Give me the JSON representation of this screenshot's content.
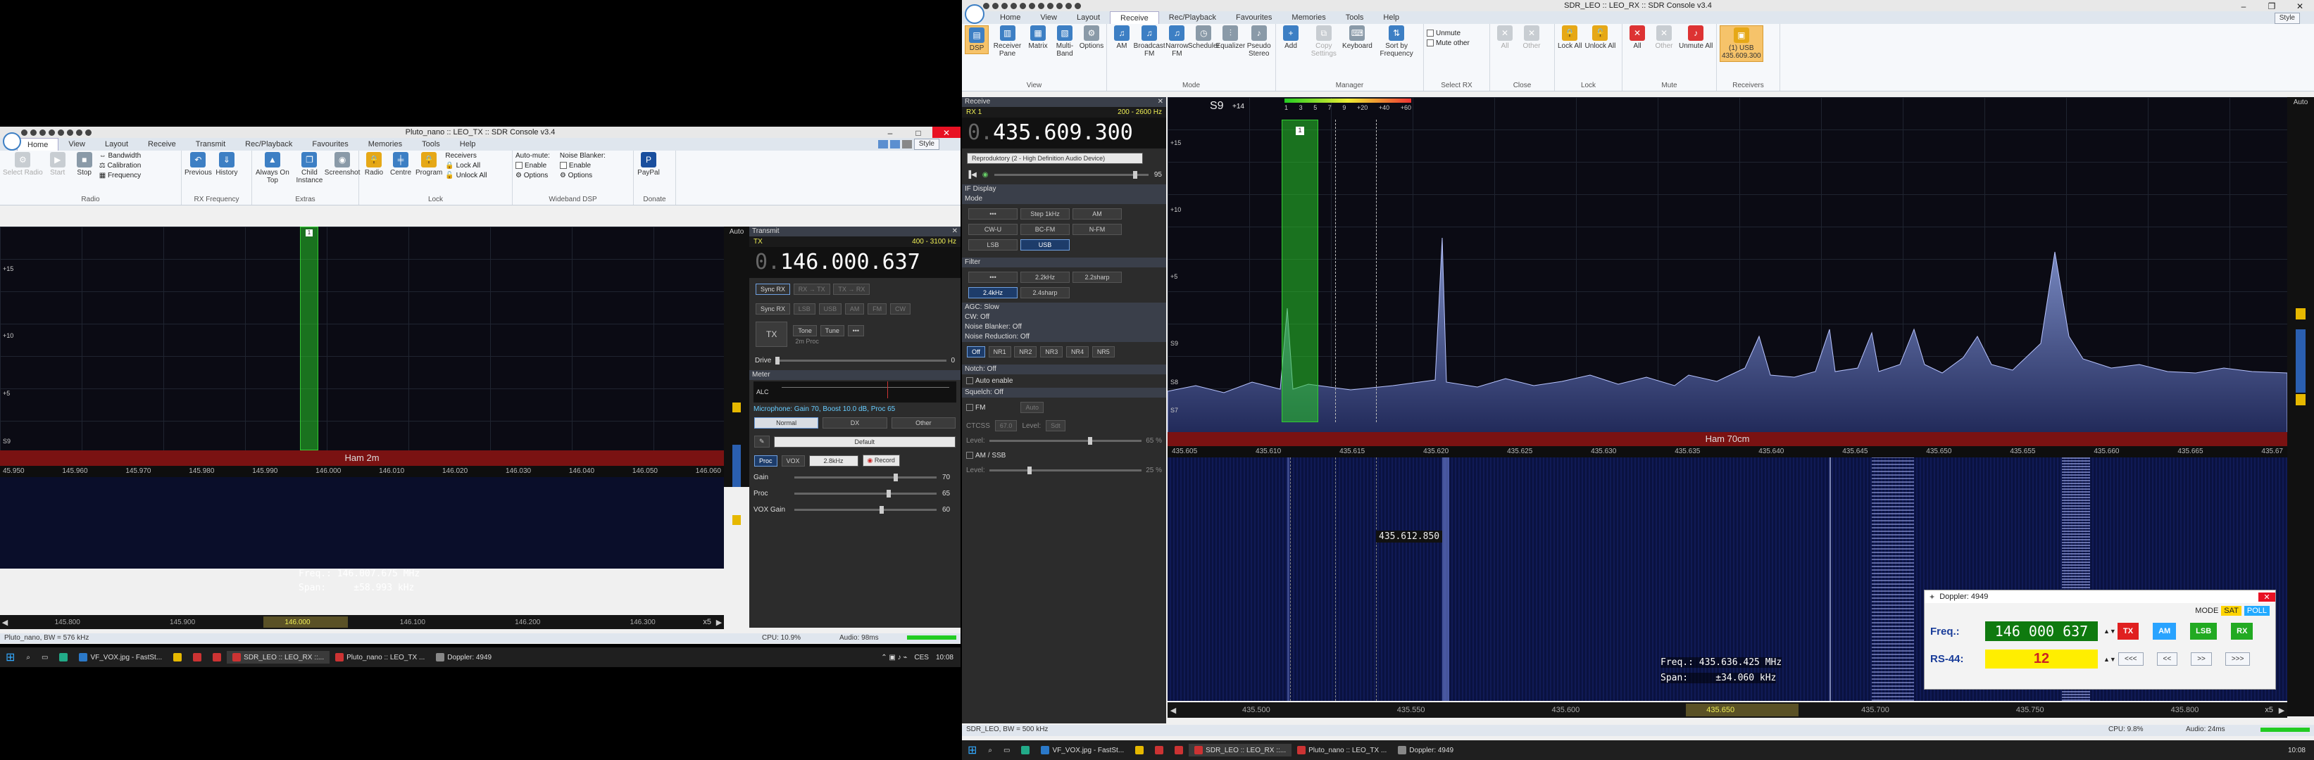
{
  "tx_window": {
    "title": "Pluto_nano :: LEO_TX :: SDR Console v3.4",
    "tabs": [
      "Home",
      "View",
      "Layout",
      "Receive",
      "Transmit",
      "Rec/Playback",
      "Favourites",
      "Memories",
      "Tools",
      "Help"
    ],
    "style_label": "Style",
    "ribbon": {
      "select_radio": "Select Radio",
      "start": "Start",
      "stop": "Stop",
      "bandwidth": "Bandwidth",
      "calibration": "Calibration",
      "frequency": "Frequency",
      "previous": "Previous",
      "history": "History",
      "always_on_top": "Always On Top",
      "child_instance": "Child Instance",
      "screenshot": "Screenshot",
      "radio": "Radio",
      "centre": "Centre",
      "program": "Program",
      "receivers": "Receivers",
      "lock_all": "Lock All",
      "unlock_all": "Unlock All",
      "auto_mute": "Auto-mute:",
      "enable": "Enable",
      "options": "Options",
      "noise_blanker": "Noise Blanker:",
      "paypal": "PayPal",
      "groups": [
        "Radio",
        "RX Frequency",
        "Extras",
        "Lock",
        "Wideband DSP",
        "Donate"
      ]
    },
    "spectrum_scale": [
      "+15",
      "+10",
      "+5",
      "S9"
    ],
    "auto_label": "Auto",
    "band_label": "Ham 2m",
    "freq_axis": [
      "45.950",
      "145.960",
      "145.970",
      "145.980",
      "145.990",
      "146.000",
      "146.010",
      "146.020",
      "146.030",
      "146.040",
      "146.050",
      "146.060"
    ],
    "cursor_freq": "Freq.: 146.007.675 MHz",
    "cursor_span": "Span:     ±58.993 kHz",
    "overview_axis": [
      "145.800",
      "145.900",
      "146.000",
      "146.100",
      "146.200",
      "146.300"
    ],
    "zoom": "x5",
    "status_left": "Pluto_nano, BW = 576 kHz",
    "cpu": "CPU: 10.9%",
    "audio": "Audio: 98ms",
    "transmit_panel": {
      "header": "Transmit",
      "tx_label": "TX",
      "filter_range": "400 - 3100 Hz",
      "freq_prefix": "0.",
      "frequency": "146.000.637",
      "sync_rx": "Sync RX",
      "rx_tx": "RX → TX",
      "tx_rx": "TX → RX",
      "modes": [
        "LSB",
        "USB",
        "AM",
        "FM",
        "CW"
      ],
      "tx_button": "TX",
      "tone": "Tone",
      "tune": "Tune",
      "more": "•••",
      "proc_label": "2m Proc",
      "drive": "Drive",
      "drive_value": "0",
      "meter_header": "Meter",
      "alc": "ALC",
      "mic_line": "Microphone: Gain 70, Boost 10.0 dB, Proc 65",
      "mic_tabs": [
        "Normal",
        "DX",
        "Other"
      ],
      "preset": "Default",
      "proc": "Proc",
      "vox": "VOX",
      "bw": "2.8kHz",
      "record": "Record",
      "gain": "Gain",
      "gain_value": "70",
      "proc_slider": "Proc",
      "proc_value": "65",
      "vox_gain": "VOX Gain",
      "vox_value": "60"
    }
  },
  "rx_window": {
    "title": "SDR_LEO :: LEO_RX :: SDR Console v3.4",
    "tabs": [
      "Home",
      "View",
      "Layout",
      "Receive",
      "Rec/Playback",
      "Favourites",
      "Memories",
      "Tools",
      "Help"
    ],
    "active_tab": "Receive",
    "style_label": "Style",
    "ribbon": {
      "dsp": "DSP",
      "receiver_pane": "Receiver Pane",
      "matrix": "Matrix",
      "multi_band": "Multi-Band",
      "options": "Options",
      "am": "AM",
      "broadcast_fm": "Broadcast FM",
      "narrow_fm": "Narrow FM",
      "scheduler": "Scheduler",
      "equalizer": "Equalizer",
      "pseudo_stereo": "Pseudo Stereo",
      "add": "Add",
      "copy_settings": "Copy Settings",
      "keyboard": "Keyboard",
      "sort_by_frequency": "Sort by Frequency",
      "unmute": "Unmute",
      "mute_other": "Mute other",
      "all": "All",
      "other": "Other",
      "lock_all": "Lock All",
      "unlock_all": "Unlock All",
      "unmute_all": "Unmute All",
      "rx1_usb": "(1) USB",
      "rx1_freq": "435.609.300",
      "groups": [
        "View",
        "Mode",
        "Manager",
        "Select RX",
        "Close",
        "Lock",
        "Mute",
        "Receivers"
      ]
    },
    "receive_panel": {
      "header": "Receive",
      "rx_label": "RX 1",
      "filter_range": "200 - 2600 Hz",
      "freq_prefix": "0.",
      "frequency": "435.609.300",
      "audio_device": "Reproduktory (2 - High Definition Audio Device)",
      "volume": "95",
      "if_display": "IF Display",
      "mode_header": "Mode",
      "modes": [
        "•••",
        "Step 1kHz",
        "AM",
        "CW-U",
        "BC-FM",
        "N-FM",
        "LSB",
        "USB"
      ],
      "active_mode": "USB",
      "filter_header": "Filter",
      "filters": [
        "•••",
        "2.2kHz",
        "2.2sharp",
        "2.4kHz",
        "2.4sharp"
      ],
      "agc": "AGC: Slow",
      "cw": "CW: Off",
      "noise_blanker": "Noise Blanker: Off",
      "noise_reduction": "Noise Reduction: Off",
      "nr_buttons": [
        "Off",
        "NR1",
        "NR2",
        "NR3",
        "NR4",
        "NR5"
      ],
      "notch": "Notch: Off",
      "auto_enable": "Auto enable",
      "squelch": "Squelch: Off",
      "fm": "FM",
      "auto": "Auto",
      "ctcss": "CTCSS",
      "ctcss_val": "67.0",
      "level": "Level:",
      "level_val": "Sdt",
      "level_pct": "65 %",
      "am_ssb": "AM / SSB",
      "level2_pct": "25 %"
    },
    "s_meter_label": "S9",
    "s_meter_plus": "+14",
    "s_meter_scale": [
      "1",
      "3",
      "5",
      "7",
      "9",
      "+20",
      "+40",
      "+60"
    ],
    "spectrum_scale": [
      "+15",
      "+10",
      "+5",
      "S9",
      "S8",
      "S7"
    ],
    "auto_label": "Auto",
    "band_label": "Ham 70cm",
    "freq_axis": [
      "435.605",
      "435.610",
      "435.615",
      "435.620",
      "435.625",
      "435.630",
      "435.635",
      "435.640",
      "435.645",
      "435.650",
      "435.655",
      "435.660",
      "435.665",
      "435.67"
    ],
    "wf_marker": "435.612.850",
    "cursor_freq": "Freq.: 435.636.425 MHz",
    "cursor_span": "Span:     ±34.060 kHz",
    "overview_axis": [
      "435.500",
      "435.550",
      "435.600",
      "435.650",
      "435.700",
      "435.750",
      "435.800"
    ],
    "zoom": "x5",
    "status_left": "SDR_LEO, BW = 500 kHz",
    "cpu": "CPU: 9.8%",
    "audio": "Audio: 24ms"
  },
  "doppler": {
    "title": "Doppler: 4949",
    "mode_label": "MODE",
    "sat": "SAT",
    "poll": "POLL",
    "freq_label": "Freq.:",
    "freq_value": "146 000 637",
    "tx": "TX",
    "am": "AM",
    "lsb": "LSB",
    "rx": "RX",
    "rs_label": "RS-44:",
    "rs_value": "12",
    "nav": [
      "<<<",
      "<<",
      ">>",
      ">>>"
    ],
    "colors": {
      "freq_bg": "#0f7a0f",
      "rs_bg": "#ffee00",
      "tx": "#e02020",
      "am": "#29a3ff",
      "lsb": "#22aa22",
      "rx": "#22aa22"
    }
  },
  "taskbar_left": {
    "items": [
      "VF_VOX.jpg - FastSt...",
      "SDR_LEO :: LEO_RX ::...",
      "Pluto_nano :: LEO_TX ...",
      "Doppler: 4949"
    ],
    "lang": "CES",
    "time": "10:08"
  },
  "taskbar_right": {
    "items": [
      "VF_VOX.jpg - FastSt...",
      "SDR_LEO :: LEO_RX ::...",
      "Pluto_nano :: LEO_TX ...",
      "Doppler: 4949"
    ],
    "time": "10:08"
  }
}
